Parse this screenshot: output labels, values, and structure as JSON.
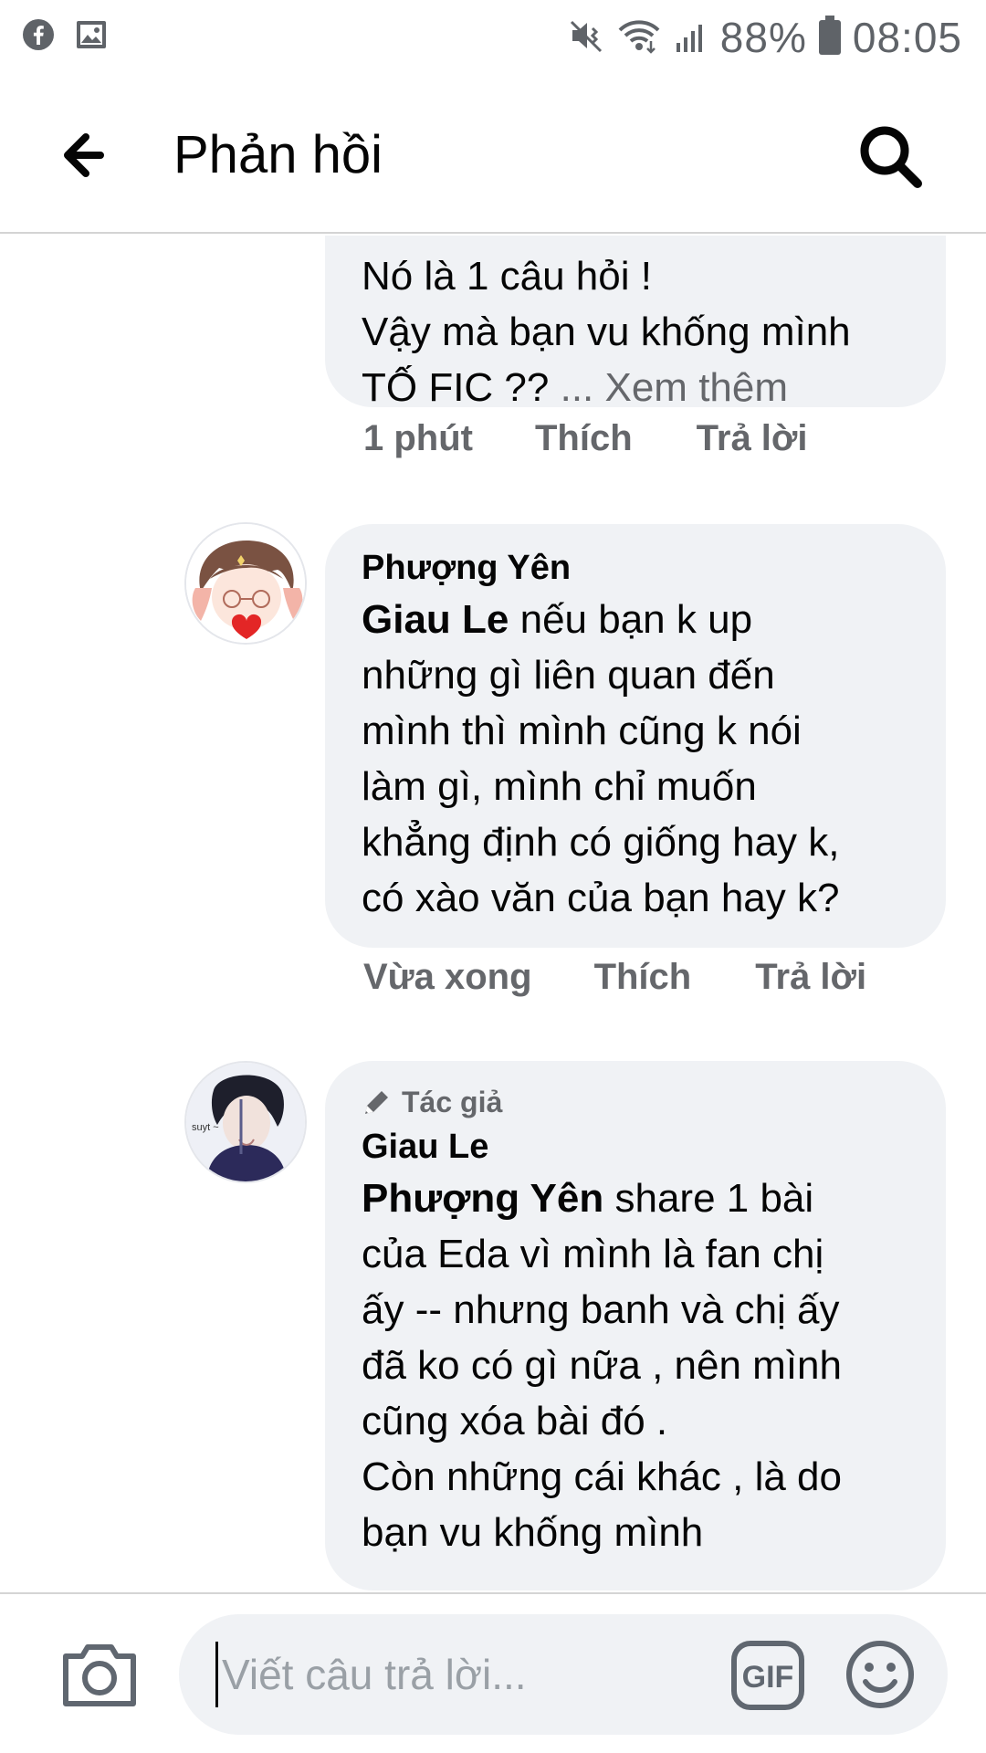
{
  "status_bar": {
    "battery": "88%",
    "time": "08:05",
    "icons": [
      "facebook-icon",
      "image-icon",
      "mute-vibrate-icon",
      "wifi-icon",
      "signal-icon",
      "battery-icon"
    ]
  },
  "header": {
    "title": "Phản hồi",
    "back_icon": "arrow-left-icon",
    "search_icon": "search-icon"
  },
  "comments": [
    {
      "text": "Nó là 1 câu hỏi !\nVậy mà bạn vu khống mình\nTỐ FIC  ??  ",
      "see_more": "... Xem thêm",
      "time": "1 phút",
      "like": "Thích",
      "reply": "Trả lời"
    },
    {
      "author": "Phượng Yên",
      "mention": "Giau Le",
      "text": " nếu bạn k up\nnhững gì liên quan đến\nmình thì mình cũng k nói\nlàm gì, mình chỉ muốn\nkhẳng định có giống hay k,\ncó xào văn của bạn hay k?",
      "time": "Vừa xong",
      "like": "Thích",
      "reply": "Trả lời"
    },
    {
      "badge": "Tác giả",
      "author": "Giau Le",
      "mention": "Phượng Yên",
      "text": " share 1 bài\ncủa Eda vì mình là fan chị\nấy -- nhưng banh và chị ấy\nđã ko có gì nữa  ,  nên mình\ncũng xóa bài đó .\nCòn những cái khác ,  là do\nbạn vu khống mình"
    }
  ],
  "reply_bar": {
    "placeholder": "Viết câu trả lời...",
    "gif_label": "GIF"
  }
}
